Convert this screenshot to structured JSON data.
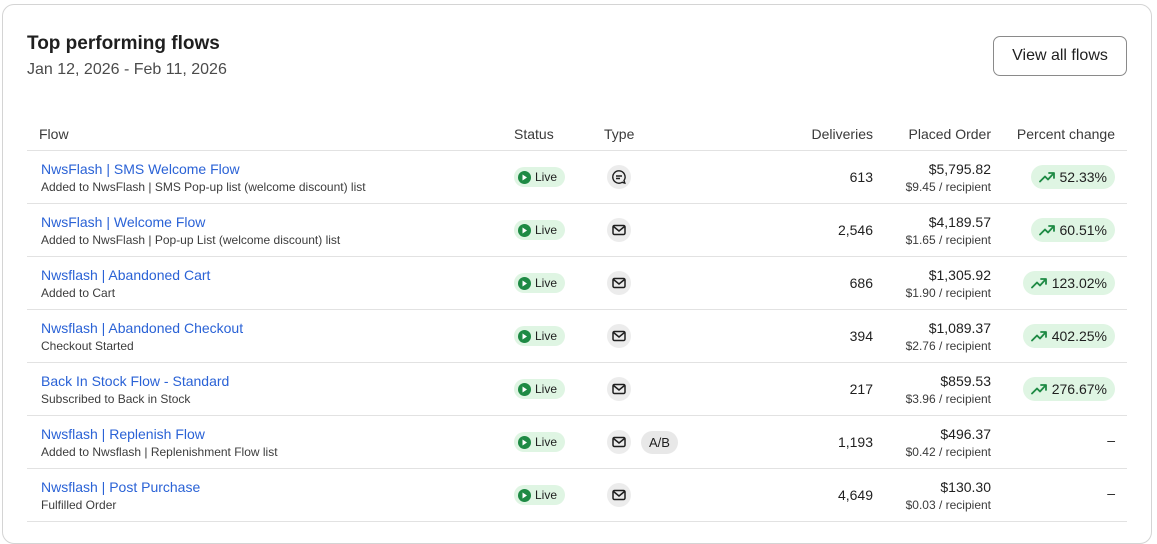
{
  "header": {
    "title": "Top performing flows",
    "date_range": "Jan 12, 2026 - Feb 11, 2026",
    "view_all_label": "View all flows"
  },
  "columns": {
    "flow": "Flow",
    "status": "Status",
    "type": "Type",
    "deliveries": "Deliveries",
    "placed_order": "Placed Order",
    "percent_change": "Percent change"
  },
  "rows": [
    {
      "name": "NwsFlash | SMS Welcome Flow",
      "trigger": "Added to NwsFlash | SMS Pop-up list (welcome discount) list",
      "status": "Live",
      "type": "sms",
      "ab": "",
      "deliveries": "613",
      "order": "$5,795.82",
      "per_recipient": "$9.45 / recipient",
      "change": "52.33%"
    },
    {
      "name": "NwsFlash | Welcome Flow",
      "trigger": "Added to NwsFlash | Pop-up List (welcome discount) list",
      "status": "Live",
      "type": "email",
      "ab": "",
      "deliveries": "2,546",
      "order": "$4,189.57",
      "per_recipient": "$1.65 / recipient",
      "change": "60.51%"
    },
    {
      "name": "Nwsflash | Abandoned Cart",
      "trigger": "Added to Cart",
      "status": "Live",
      "type": "email",
      "ab": "",
      "deliveries": "686",
      "order": "$1,305.92",
      "per_recipient": "$1.90 / recipient",
      "change": "123.02%"
    },
    {
      "name": "Nwsflash | Abandoned Checkout",
      "trigger": "Checkout Started",
      "status": "Live",
      "type": "email",
      "ab": "",
      "deliveries": "394",
      "order": "$1,089.37",
      "per_recipient": "$2.76 / recipient",
      "change": "402.25%"
    },
    {
      "name": "Back In Stock Flow - Standard",
      "trigger": "Subscribed to Back in Stock",
      "status": "Live",
      "type": "email",
      "ab": "",
      "deliveries": "217",
      "order": "$859.53",
      "per_recipient": "$3.96 / recipient",
      "change": "276.67%"
    },
    {
      "name": "Nwsflash | Replenish Flow",
      "trigger": "Added to Nwsflash | Replenishment Flow list",
      "status": "Live",
      "type": "email",
      "ab": "A/B",
      "deliveries": "1,193",
      "order": "$496.37",
      "per_recipient": "$0.42 / recipient",
      "change": "–"
    },
    {
      "name": "Nwsflash | Post Purchase",
      "trigger": "Fulfilled Order",
      "status": "Live",
      "type": "email",
      "ab": "",
      "deliveries": "4,649",
      "order": "$130.30",
      "per_recipient": "$0.03 / recipient",
      "change": "–"
    }
  ],
  "colors": {
    "link": "#2a62d6",
    "live_bg": "#dff5e3",
    "live_dot": "#1e8a44",
    "trend_up": "#1e8a44"
  },
  "icons": {
    "sms": "chat-bubble-icon",
    "email": "envelope-icon",
    "live": "play-circle-icon",
    "trend": "trend-up-icon"
  }
}
